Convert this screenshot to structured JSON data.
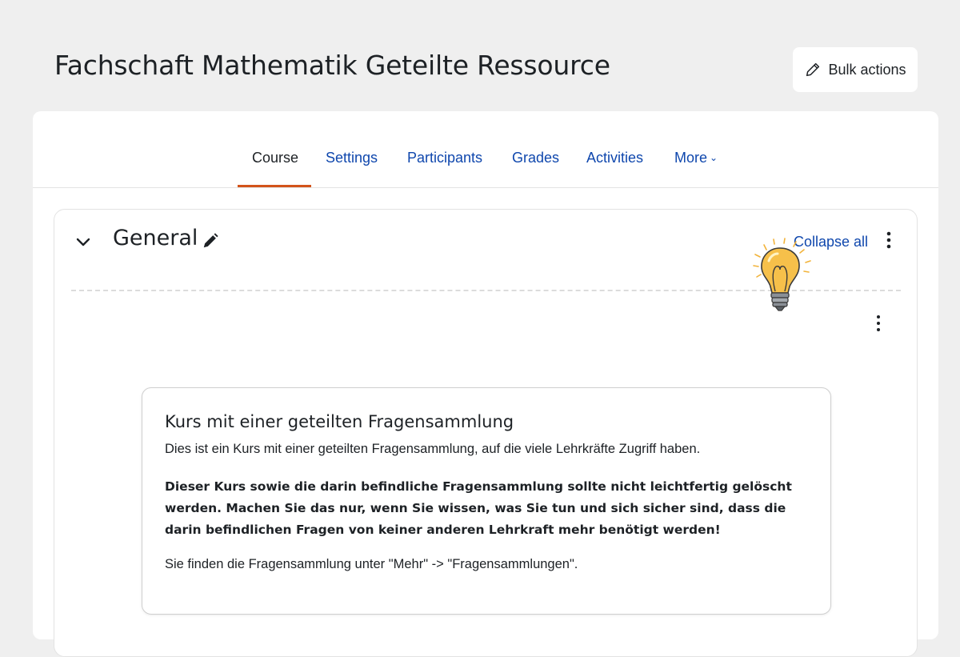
{
  "header": {
    "title": "Fachschaft Mathematik Geteilte Ressource",
    "bulk_actions_label": "Bulk actions"
  },
  "tabs": [
    {
      "label": "Course",
      "active": true
    },
    {
      "label": "Settings",
      "active": false
    },
    {
      "label": "Participants",
      "active": false
    },
    {
      "label": "Grades",
      "active": false
    },
    {
      "label": "Activities",
      "active": false
    },
    {
      "label": "More",
      "active": false
    }
  ],
  "section": {
    "title": "General",
    "collapse_all_label": "Collapse all"
  },
  "info_box": {
    "title": "Kurs mit einer geteilten Fragensammlung",
    "text": "Dies ist ein Kurs mit einer geteilten Fragensammlung, auf die viele Lehrkräfte Zugriff haben.",
    "bold_text": "Dieser Kurs sowie die darin befindliche Fragensammlung sollte nicht leichtfertig gelöscht werden. Machen Sie das nur, wenn Sie wissen, was Sie tun und sich sicher sind, dass die darin befindlichen Fragen von keiner anderen Lehrkraft mehr benötigt werden!",
    "footer_text": "Sie finden die Fragensammlung unter \"Mehr\" -> \"Fragensammlungen\"."
  },
  "icons": {
    "bulk_actions": "pencil-icon",
    "section_toggle": "chevron-down-icon",
    "section_edit": "pencil-icon",
    "menu": "kebab-menu-icon",
    "illustration": "lightbulb-icon"
  },
  "colors": {
    "link": "#0f47ad",
    "active_tab_underline": "#d3531a",
    "background": "#efefef",
    "bulb": "#f6c04a"
  }
}
